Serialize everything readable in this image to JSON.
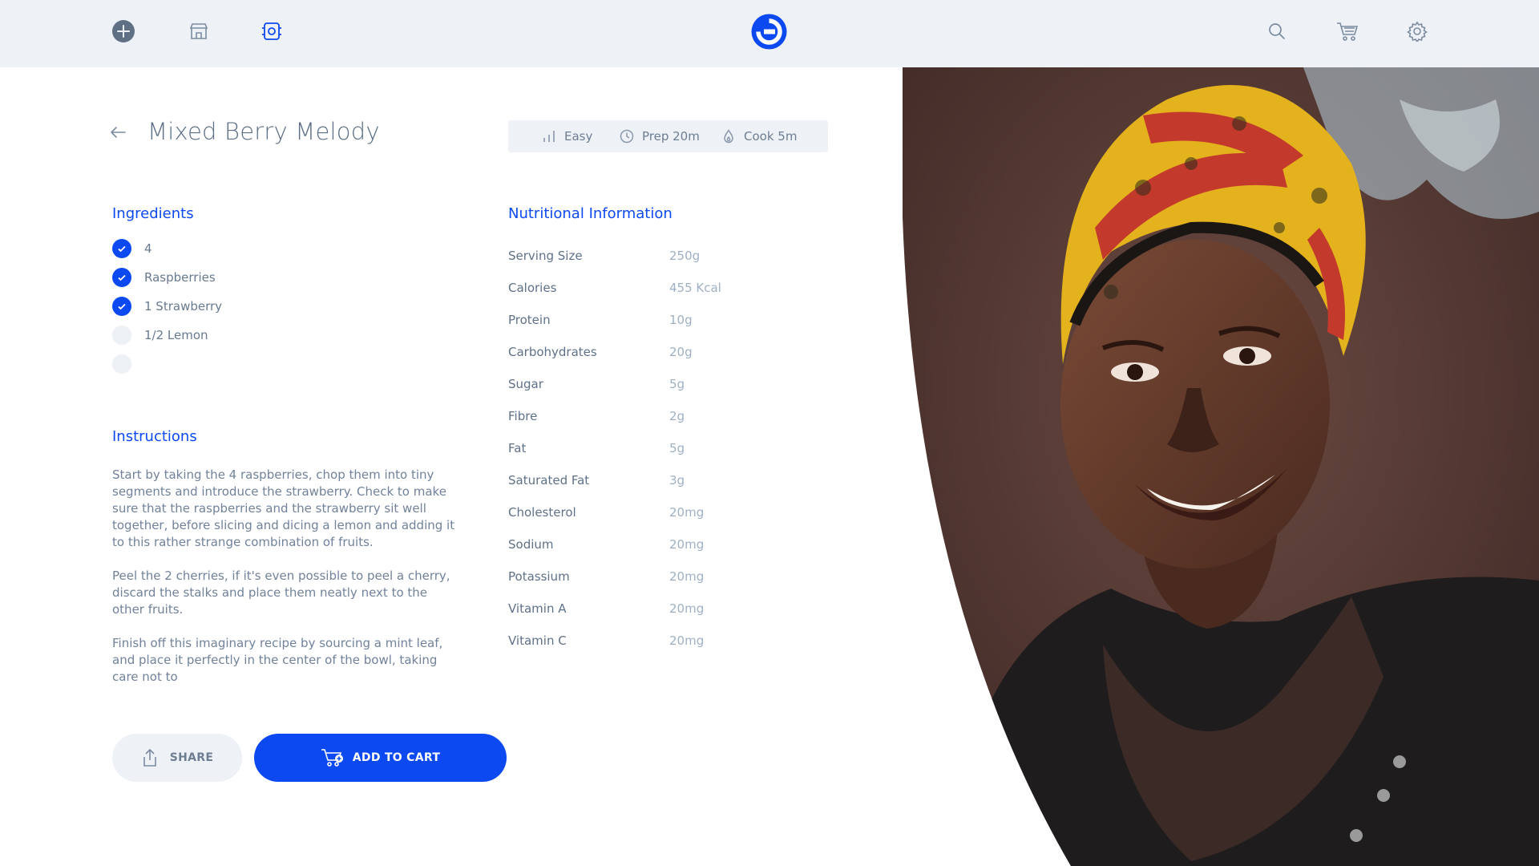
{
  "topbar": {
    "left_icons": [
      "plus-circle-icon",
      "store-icon",
      "fridge-icon"
    ],
    "logo": "brand-logo",
    "right_icons": [
      "search-icon",
      "cart-icon",
      "settings-icon"
    ]
  },
  "recipe": {
    "title": "Mixed Berry Melody",
    "meta": {
      "difficulty": "Easy",
      "prep": "Prep 20m",
      "cook": "Cook 5m"
    }
  },
  "ingredients": {
    "heading": "Ingredients",
    "items": [
      {
        "label": "4",
        "checked": true
      },
      {
        "label": "Raspberries",
        "checked": true
      },
      {
        "label": "1 Strawberry",
        "checked": true
      },
      {
        "label": "1/2 Lemon",
        "checked": false
      },
      {
        "label": "",
        "checked": false
      }
    ]
  },
  "instructions": {
    "heading": "Instructions",
    "paragraphs": [
      "Start by taking the 4 raspberries, chop them into tiny segments and introduce the strawberry. Check to make sure that the raspberries and the strawberry sit well together, before slicing and dicing a lemon and adding it to this rather strange combination of fruits.",
      "Peel the 2 cherries, if it's even possible to peel a cherry, discard the stalks and place them neatly next to the other fruits.",
      "Finish off this imaginary recipe by sourcing a mint leaf, and place it perfectly in the center of the bowl, taking care not to"
    ]
  },
  "nutrition": {
    "heading": "Nutritional Information",
    "rows": [
      {
        "name": "Serving Size",
        "value": "250g"
      },
      {
        "name": "Calories",
        "value": "455 Kcal"
      },
      {
        "name": "Protein",
        "value": "10g"
      },
      {
        "name": "Carbohydrates",
        "value": "20g"
      },
      {
        "name": "Sugar",
        "value": "5g"
      },
      {
        "name": "Fibre",
        "value": "2g"
      },
      {
        "name": "Fat",
        "value": "5g"
      },
      {
        "name": "Saturated Fat",
        "value": "3g"
      },
      {
        "name": "Cholesterol",
        "value": "20mg"
      },
      {
        "name": "Sodium",
        "value": "20mg"
      },
      {
        "name": "Potassium",
        "value": "20mg"
      },
      {
        "name": "Vitamin A",
        "value": "20mg"
      },
      {
        "name": "Vitamin C",
        "value": "20mg"
      }
    ]
  },
  "actions": {
    "share_label": "SHARE",
    "cart_label": "ADD TO CART"
  },
  "colors": {
    "accent": "#0c49f0",
    "topbar_bg": "#eef2f7",
    "text_muted": "#71829a"
  }
}
